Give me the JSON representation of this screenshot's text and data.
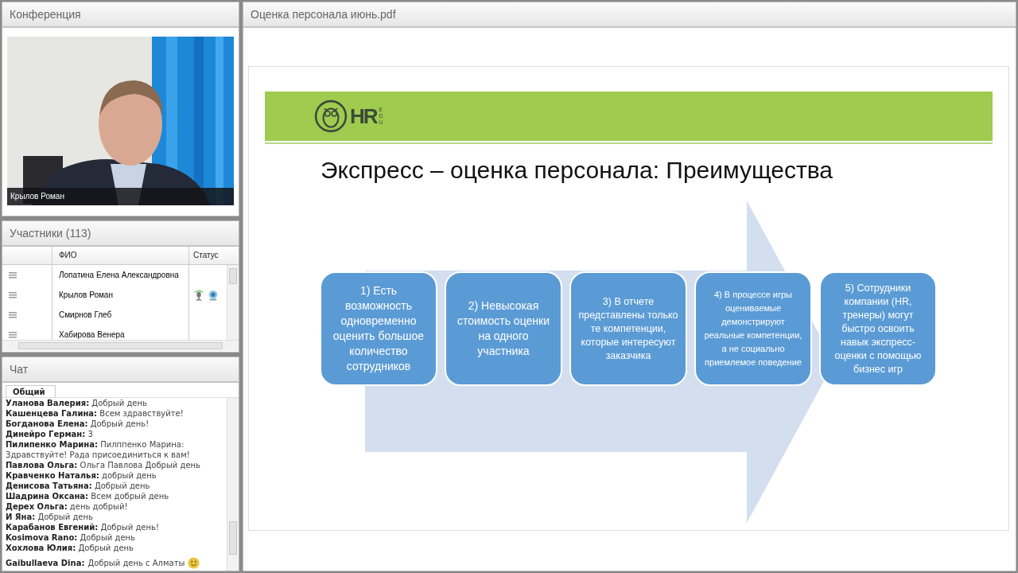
{
  "conference": {
    "title": "Конференция",
    "video": {
      "kind": "picture",
      "caption": "Крылов Роман"
    }
  },
  "participants": {
    "title": "Участники (113)",
    "columns": [
      "ФИО",
      "Статус"
    ],
    "rows": [
      {
        "name": "Лопатина Елена Александровна",
        "microphone": false,
        "camera": false
      },
      {
        "name": "Крылов Роман",
        "microphone": true,
        "camera": true
      },
      {
        "name": "Смирнов Глеб",
        "microphone": false,
        "camera": false
      },
      {
        "name": "Хабирова Венера",
        "microphone": false,
        "camera": false
      }
    ]
  },
  "chat": {
    "title": "Чат",
    "tabs": [
      {
        "label": "Общий",
        "selected": true
      }
    ],
    "messages": [
      {
        "author": "Уланова Валерия:",
        "text": "Добрый день",
        "emoji": false
      },
      {
        "author": "Кашенцева Галина:",
        "text": "Всем здравствуйте!",
        "emoji": false
      },
      {
        "author": "Богданова Елена:",
        "text": "Добрый день!",
        "emoji": false
      },
      {
        "author": "Динейро Герман:",
        "text": "3",
        "emoji": false
      },
      {
        "author": "Пилипенко Марина:",
        "text": "Пилппенко Марина: Здравствуйте! Рада присоединиться к вам!",
        "emoji": false
      },
      {
        "author": "Павлова Ольга:",
        "text": "Ольга  Павлова Добрый день",
        "emoji": false
      },
      {
        "author": "Кравченко Наталья:",
        "text": "добрый день",
        "emoji": false
      },
      {
        "author": "Денисова Татьяна:",
        "text": "Добрый день",
        "emoji": false
      },
      {
        "author": "Шадрина Оксана:",
        "text": "Всем добрый день",
        "emoji": false
      },
      {
        "author": "Дерех Ольга:",
        "text": "день добрый!",
        "emoji": false
      },
      {
        "author": "И Яна:",
        "text": "Добрый день",
        "emoji": false
      },
      {
        "author": "Карабанов Евгений:",
        "text": "Добрый день!",
        "emoji": false
      },
      {
        "author": "Kosimova Rano:",
        "text": "Добрый день",
        "emoji": false
      },
      {
        "author": "Хохлова Юлия:",
        "text": "Добрый день",
        "emoji": false
      },
      {
        "author": "Gaibullaeva Dina:",
        "text": "Добрый день с Алматы",
        "emoji": true
      }
    ]
  },
  "document": {
    "title": "Оценка персонала июнь.pdf",
    "slide": {
      "logo": "HR",
      "logo_sub": "EDU",
      "heading": "Экспресс – оценка персонала: Преимущества",
      "steps": [
        "1) Есть возможность одновременно оценить большое количество сотрудников",
        "2) Невысокая стоимость оценки на одного участника",
        "3) В отчете представлены только те компетенции, которые интересуют заказчика",
        "4) В процессе игры оцениваемые демонстрируют реальные компетенции, а не социально приемлемое поведение",
        "5) Сотрудники компании (HR, тренеры) могут быстро освоить навык экспресс-оценки с помощью бизнес игр"
      ]
    }
  }
}
